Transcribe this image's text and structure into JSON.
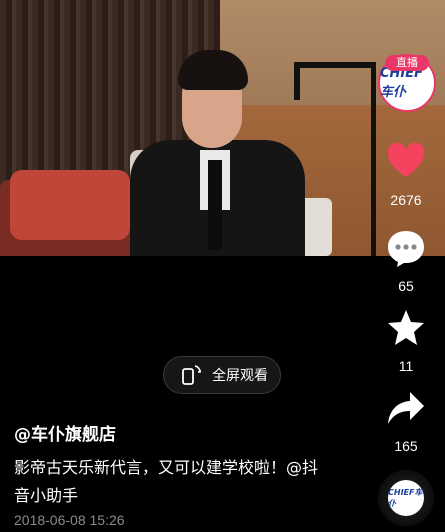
{
  "video": {
    "live_badge": "直播",
    "avatar_brand": "CHIEF车仆"
  },
  "rail": {
    "likes": "2676",
    "comments": "65",
    "favorites": "11",
    "shares": "165"
  },
  "fullscreen": {
    "label": "全屏观看"
  },
  "post": {
    "author": "@车仆旗舰店",
    "description": "影帝古天乐新代言，又可以建学校啦！@抖音小助手",
    "date": "2018-06-08 15:26"
  },
  "disc": {
    "brand": "CHIEF车仆"
  },
  "colors": {
    "like": "#f5425f",
    "live": "#ea3768",
    "brand_blue": "#1c3e9b"
  }
}
